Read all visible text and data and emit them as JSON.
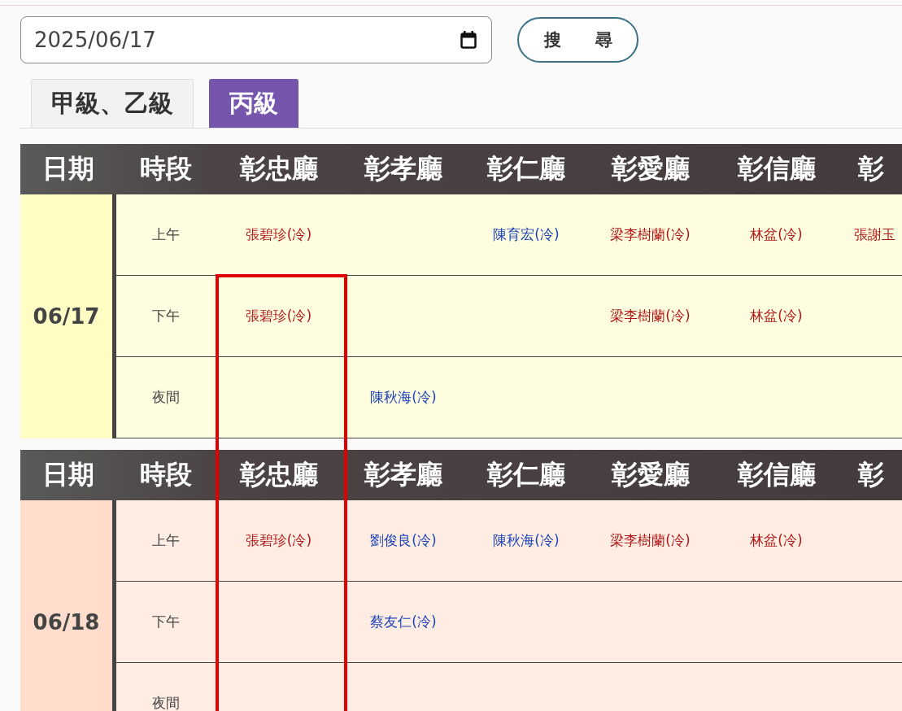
{
  "date_field": {
    "value": "2025/06/17"
  },
  "search_button": {
    "label": "搜　　尋"
  },
  "tabs": [
    {
      "label": "甲級、乙級",
      "selected": false
    },
    {
      "label": "丙級",
      "selected": true
    }
  ],
  "annotation": {
    "kind": "frame"
  },
  "schedule": [
    {
      "headers": [
        "日期",
        "時段",
        "彰忠廳",
        "彰孝廳",
        "彰仁廳",
        "彰愛廳",
        "彰信廳",
        "彰"
      ],
      "date": "06/17",
      "color": "#fffcc4",
      "periods": [
        {
          "label": "上午",
          "cells": [
            {
              "text": "張碧珍(冷)",
              "color": "#b01818"
            },
            null,
            {
              "text": "陳育宏(冷)",
              "color": "#1d44b8"
            },
            {
              "text": "梁李樹蘭(冷)",
              "color": "#b01818"
            },
            {
              "text": "林盆(冷)",
              "color": "#b01818"
            },
            {
              "text": "張謝玉",
              "color": "#b01818"
            }
          ]
        },
        {
          "label": "下午",
          "cells": [
            {
              "text": "張碧珍(冷)",
              "color": "#b01818"
            },
            null,
            null,
            {
              "text": "梁李樹蘭(冷)",
              "color": "#b01818"
            },
            {
              "text": "林盆(冷)",
              "color": "#b01818"
            },
            null
          ]
        },
        {
          "label": "夜間",
          "cells": [
            null,
            {
              "text": "陳秋海(冷)",
              "color": "#1d44b8"
            },
            null,
            null,
            null,
            null
          ]
        }
      ]
    },
    {
      "headers": [
        "日期",
        "時段",
        "彰忠廳",
        "彰孝廳",
        "彰仁廳",
        "彰愛廳",
        "彰信廳",
        "彰"
      ],
      "date": "06/18",
      "color": "#ffdccb",
      "periods": [
        {
          "label": "上午",
          "cells": [
            {
              "text": "張碧珍(冷)",
              "color": "#b01818"
            },
            {
              "text": "劉俊良(冷)",
              "color": "#1d44b8"
            },
            {
              "text": "陳秋海(冷)",
              "color": "#1d44b8"
            },
            {
              "text": "梁李樹蘭(冷)",
              "color": "#b01818"
            },
            {
              "text": "林盆(冷)",
              "color": "#b01818"
            },
            null
          ]
        },
        {
          "label": "下午",
          "cells": [
            null,
            {
              "text": "蔡友仁(冷)",
              "color": "#1d44b8"
            },
            null,
            null,
            null,
            null
          ]
        },
        {
          "label": "夜間",
          "cells": [
            null,
            null,
            null,
            null,
            null,
            null
          ]
        }
      ]
    }
  ]
}
